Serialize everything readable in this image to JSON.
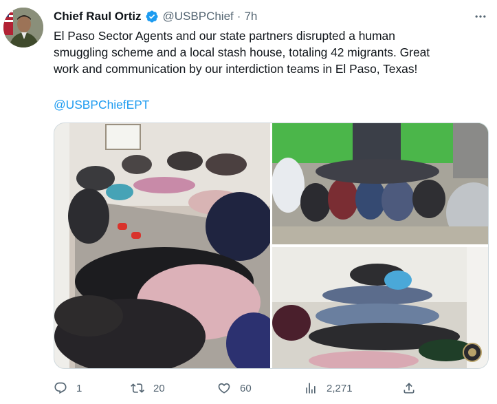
{
  "tweet": {
    "author": {
      "display_name": "Chief Raul Ortiz",
      "handle": "@USBPChief",
      "verified": true,
      "avatar_icon": "profile-photo"
    },
    "separator": "·",
    "time": "7h",
    "more_icon": "ellipsis-icon",
    "text_lines": [
      "El Paso Sector Agents and our state partners disrupted a human",
      "smuggling scheme and a local stash house, totaling 42 migrants. Great",
      "work and communication by our interdiction teams in El Paso, Texas!"
    ],
    "mention": "@USBPChiefEPT",
    "media": {
      "photo_count": 3
    },
    "actions": {
      "reply_count": "1",
      "retweet_count": "20",
      "like_count": "60",
      "views_count": "2,271"
    }
  },
  "colors": {
    "text": "#0f1419",
    "secondary": "#536471",
    "link": "#1d9bf0",
    "verified": "#1d9bf0"
  }
}
